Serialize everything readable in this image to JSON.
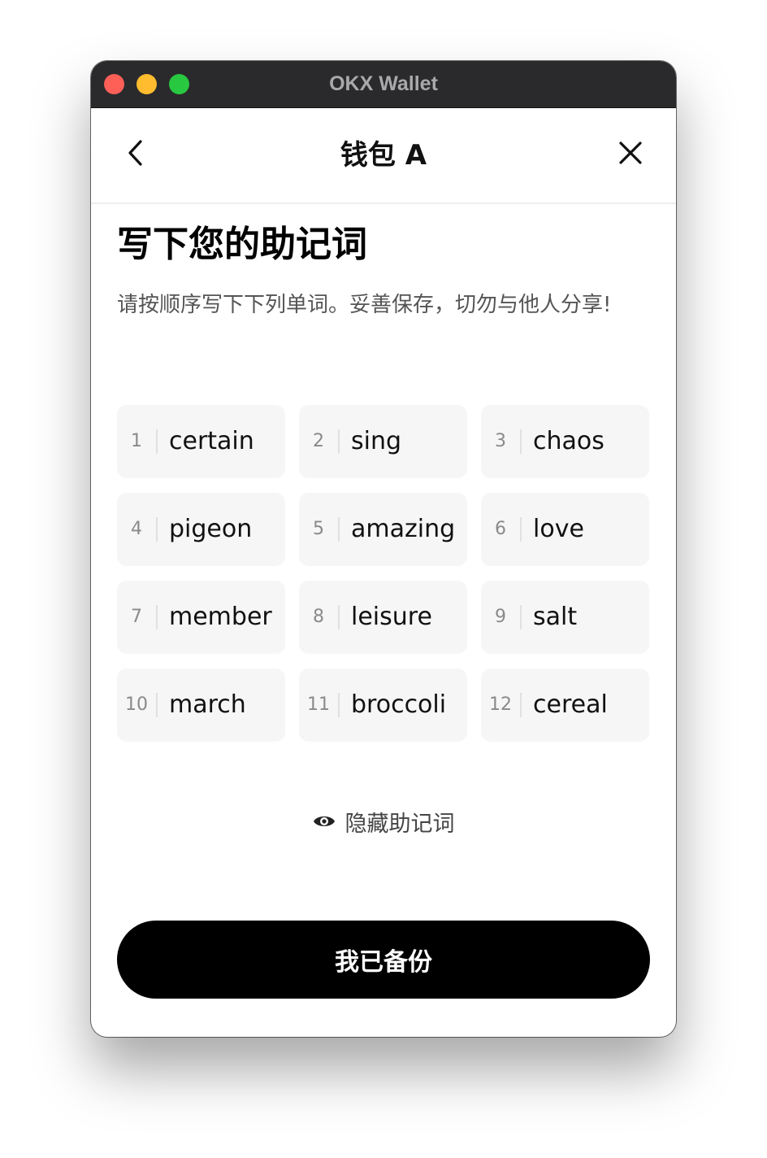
{
  "window": {
    "title": "OKX Wallet"
  },
  "nav": {
    "title": "钱包 A",
    "back_icon": "chevron-left-icon",
    "close_icon": "close-icon"
  },
  "page": {
    "heading": "写下您的助记词",
    "subtitle": "请按顺序写下下列单词。妥善保存，切勿与他人分享!"
  },
  "mnemonic": [
    {
      "num": "1",
      "word": "certain"
    },
    {
      "num": "2",
      "word": "sing"
    },
    {
      "num": "3",
      "word": "chaos"
    },
    {
      "num": "4",
      "word": "pigeon"
    },
    {
      "num": "5",
      "word": "amazing"
    },
    {
      "num": "6",
      "word": "love"
    },
    {
      "num": "7",
      "word": "member"
    },
    {
      "num": "8",
      "word": "leisure"
    },
    {
      "num": "9",
      "word": "salt"
    },
    {
      "num": "10",
      "word": "march"
    },
    {
      "num": "11",
      "word": "broccoli"
    },
    {
      "num": "12",
      "word": "cereal"
    }
  ],
  "hide_toggle": {
    "label": "隐藏助记词",
    "icon": "eye-icon"
  },
  "confirm_button": {
    "label": "我已备份"
  },
  "colors": {
    "titlebar": "#2a2a2c",
    "close_dot": "#fe5f57",
    "minimize_dot": "#febc2e",
    "zoom_dot": "#28c840",
    "cell_bg": "#f6f6f6",
    "primary": "#000000"
  }
}
